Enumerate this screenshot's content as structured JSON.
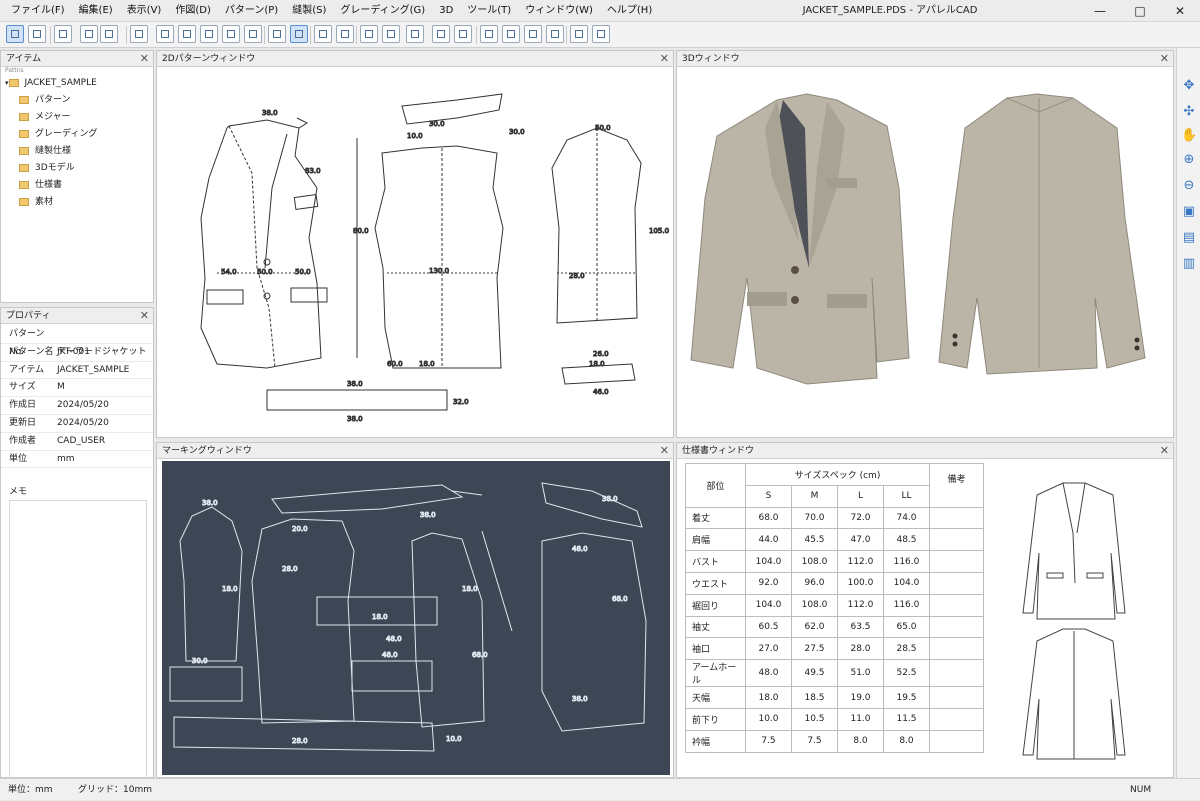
{
  "window": {
    "title": "JACKET_SAMPLE.PDS - アパレルCAD",
    "minimize": "—",
    "maximize": "□",
    "close": "✕"
  },
  "menu": [
    "ファイル(F)",
    "編集(E)",
    "表示(V)",
    "作図(D)",
    "パターン(P)",
    "縫製(S)",
    "グレーディング(G)",
    "3D",
    "ツール(T)",
    "ウィンドウ(W)",
    "ヘルプ(H)"
  ],
  "items_panel": {
    "title": "アイテム",
    "root_label": "Pattns",
    "root": "JACKET_SAMPLE",
    "children": [
      "パターン",
      "メジャー",
      "グレーディング",
      "縫製仕様",
      "3Dモデル",
      "仕様書",
      "素材"
    ]
  },
  "properties": {
    "title": "プロパティ",
    "rows": [
      {
        "k": "パターンNo.",
        "v": "JKT-001"
      },
      {
        "k": "パターン名",
        "v": "テーラードジャケット"
      },
      {
        "k": "アイテム",
        "v": "JACKET_SAMPLE"
      },
      {
        "k": "サイズ",
        "v": "M"
      },
      {
        "k": "作成日",
        "v": "2024/05/20"
      },
      {
        "k": "更新日",
        "v": "2024/05/20"
      },
      {
        "k": "作成者",
        "v": "CAD_USER"
      },
      {
        "k": "単位",
        "v": "mm"
      }
    ],
    "memo_label": "メモ"
  },
  "pattern_window": {
    "title": "2Dパターンウィンドウ",
    "labels": [
      "38.0",
      "83.0",
      "30.0",
      "10.0",
      "30.0",
      "80.0",
      "54.0",
      "50.0",
      "50.0",
      "130.0",
      "18.0",
      "105.0",
      "50.0",
      "28.0",
      "18.0",
      "26.0",
      "46.0",
      "38.0",
      "38.0",
      "60.0",
      "32.0"
    ]
  },
  "view3d": {
    "title": "3Dウィンドウ"
  },
  "marking_window": {
    "title": "マーキングウィンドウ",
    "labels": [
      "38.0",
      "18.0",
      "20.0",
      "28.0",
      "18.0",
      "48.0",
      "38.0",
      "18.0",
      "48.0",
      "38.0",
      "68.0",
      "30.0",
      "48.0",
      "68.0",
      "28.0",
      "10.0",
      "38.0"
    ]
  },
  "spec_window": {
    "title": "仕様書ウィンドウ",
    "header_part": "部位",
    "header_spec": "サイズスペック (cm)",
    "header_note": "備考",
    "sizes": [
      "S",
      "M",
      "L",
      "LL"
    ],
    "rows": [
      {
        "part": "着丈",
        "v": [
          "68.0",
          "70.0",
          "72.0",
          "74.0"
        ]
      },
      {
        "part": "肩幅",
        "v": [
          "44.0",
          "45.5",
          "47.0",
          "48.5"
        ]
      },
      {
        "part": "バスト",
        "v": [
          "104.0",
          "108.0",
          "112.0",
          "116.0"
        ]
      },
      {
        "part": "ウエスト",
        "v": [
          "92.0",
          "96.0",
          "100.0",
          "104.0"
        ]
      },
      {
        "part": "裾回り",
        "v": [
          "104.0",
          "108.0",
          "112.0",
          "116.0"
        ]
      },
      {
        "part": "袖丈",
        "v": [
          "60.5",
          "62.0",
          "63.5",
          "65.0"
        ]
      },
      {
        "part": "袖口",
        "v": [
          "27.0",
          "27.5",
          "28.0",
          "28.5"
        ]
      },
      {
        "part": "アームホール",
        "v": [
          "48.0",
          "49.5",
          "51.0",
          "52.5"
        ]
      },
      {
        "part": "天幅",
        "v": [
          "18.0",
          "18.5",
          "19.0",
          "19.5"
        ]
      },
      {
        "part": "前下り",
        "v": [
          "10.0",
          "10.5",
          "11.0",
          "11.5"
        ]
      },
      {
        "part": "衿幅",
        "v": [
          "7.5",
          "7.5",
          "8.0",
          "8.0"
        ]
      }
    ]
  },
  "statusbar": {
    "unit": "単位：mm",
    "grid": "グリッド：10mm",
    "num": "NUM"
  },
  "colors": {
    "accent": "#3b78c4",
    "marking_bg": "#3d4654",
    "jacket": "#b9b3a6"
  }
}
